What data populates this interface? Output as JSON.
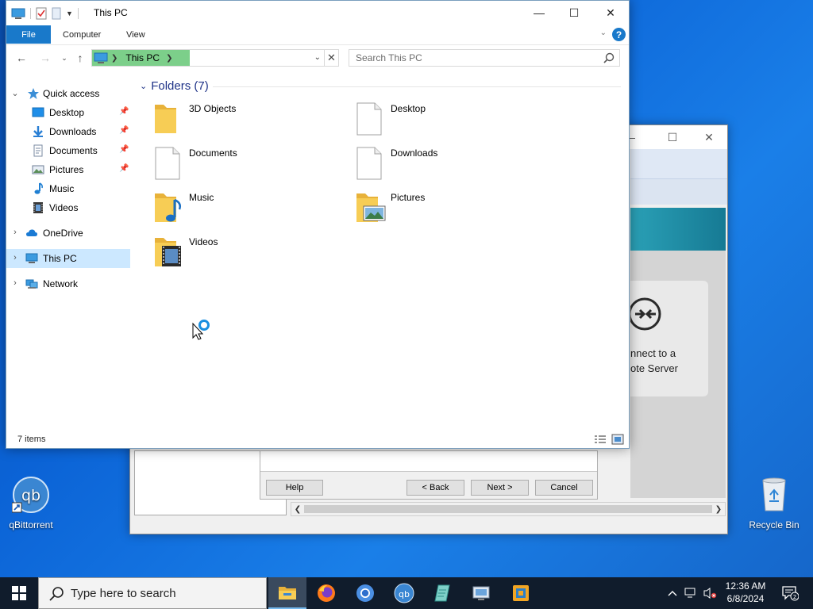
{
  "explorer": {
    "title": "This PC",
    "ribbon_tabs": {
      "file": "File",
      "computer": "Computer",
      "view": "View"
    },
    "address": {
      "crumb": "This PC"
    },
    "search": {
      "placeholder": "Search This PC"
    },
    "nav": {
      "quick_access": "Quick access",
      "quick_items": [
        {
          "label": "Desktop",
          "icon": "desktop-folder-icon",
          "pinned": true
        },
        {
          "label": "Downloads",
          "icon": "downloads-folder-icon",
          "pinned": true
        },
        {
          "label": "Documents",
          "icon": "documents-folder-icon",
          "pinned": true
        },
        {
          "label": "Pictures",
          "icon": "pictures-folder-icon",
          "pinned": true
        },
        {
          "label": "Music",
          "icon": "music-icon",
          "pinned": false
        },
        {
          "label": "Videos",
          "icon": "videos-icon",
          "pinned": false
        }
      ],
      "onedrive": "OneDrive",
      "this_pc": "This PC",
      "network": "Network"
    },
    "group_header": "Folders (7)",
    "folders": [
      {
        "name": "3D Objects",
        "icon": "folder-icon"
      },
      {
        "name": "Desktop",
        "icon": "blank-file-icon"
      },
      {
        "name": "Documents",
        "icon": "blank-file-icon"
      },
      {
        "name": "Downloads",
        "icon": "blank-file-icon"
      },
      {
        "name": "Music",
        "icon": "music-folder-icon"
      },
      {
        "name": "Pictures",
        "icon": "pictures-folder-icon"
      },
      {
        "name": "Videos",
        "icon": "videos-folder-icon"
      }
    ],
    "status": {
      "item_count": "7 items"
    }
  },
  "wizard": {
    "card_text_line1": "nnect to a",
    "card_text_line2": "ote Server",
    "buttons": {
      "help": "Help",
      "back": "< Back",
      "next": "Next >",
      "cancel": "Cancel"
    }
  },
  "desktop": {
    "icons": {
      "qbittorrent": "qBittorrent",
      "recycle_bin": "Recycle Bin"
    }
  },
  "taskbar": {
    "search_placeholder": "Type here to search",
    "clock": {
      "time": "12:36 AM",
      "date": "6/8/2024"
    },
    "notification_count": "2"
  },
  "colors": {
    "accent": "#1979ca",
    "selection": "#cce8ff",
    "folder": "#f7c94a",
    "taskbar": "#101c2c"
  }
}
